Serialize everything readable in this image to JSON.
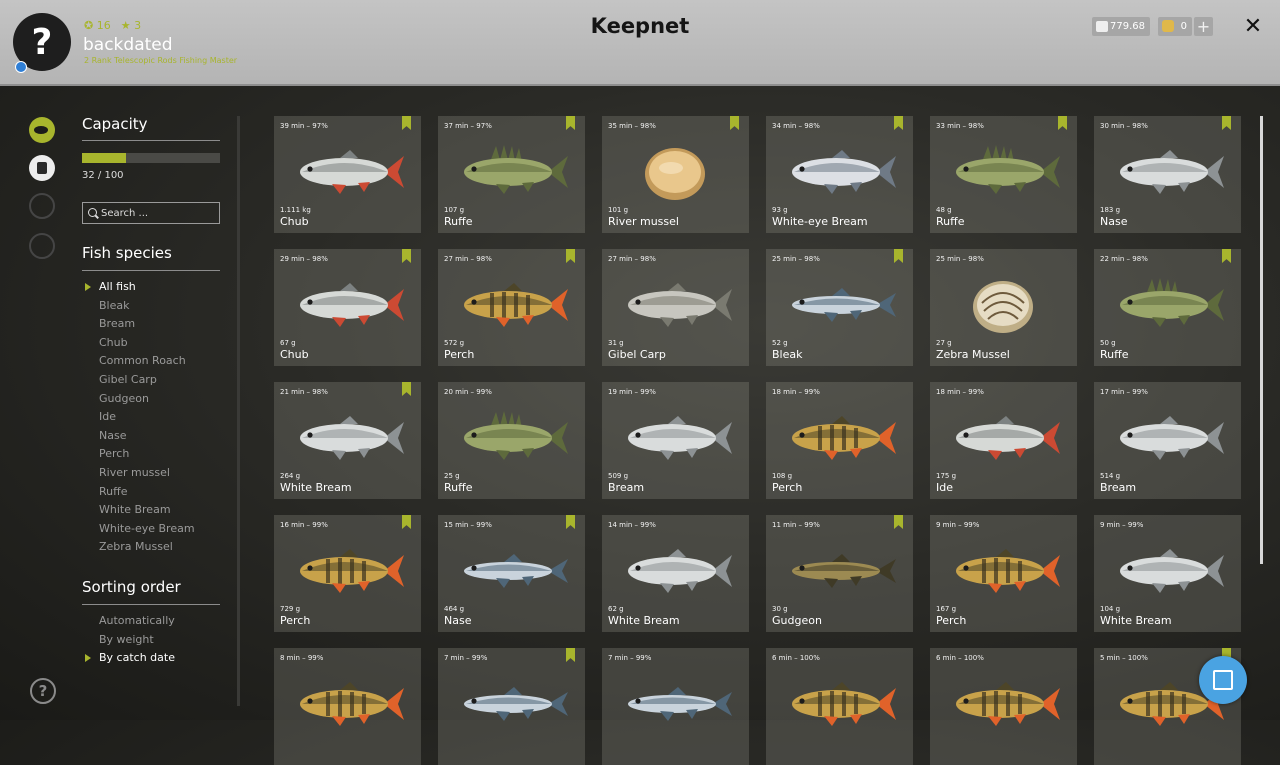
{
  "header": {
    "title": "Keepnet",
    "player": {
      "level_icon": "circle-level-icon",
      "level": "16",
      "rank_icon": "star-rank-icon",
      "rank": "3",
      "name": "backdated",
      "subtitle": "2 Rank Telescopic Rods Fishing Master"
    },
    "currency": {
      "silver": "779.68",
      "gold": "0"
    }
  },
  "sidebar": {
    "capacity": {
      "title": "Capacity",
      "used": 32,
      "max": 100,
      "label": "32 / 100"
    },
    "search": {
      "placeholder": "Search ..."
    },
    "species": {
      "title": "Fish species",
      "items": [
        "All fish",
        "Bleak",
        "Bream",
        "Chub",
        "Common Roach",
        "Gibel Carp",
        "Gudgeon",
        "Ide",
        "Nase",
        "Perch",
        "River mussel",
        "Ruffe",
        "White Bream",
        "White-eye Bream",
        "Zebra Mussel"
      ],
      "selected": "All fish"
    },
    "sorting": {
      "title": "Sorting order",
      "items": [
        "Automatically",
        "By weight",
        "By catch date"
      ],
      "selected": "By catch date"
    }
  },
  "colors": {
    "accent": "#a8b52d",
    "fab": "#4aa3e2"
  },
  "fish": [
    {
      "time": "39 min – 97%",
      "weight": "1.111 kg",
      "name": "Chub",
      "marked": true,
      "kind": "silver-red"
    },
    {
      "time": "37 min – 97%",
      "weight": "107 g",
      "name": "Ruffe",
      "marked": true,
      "kind": "spiny-green"
    },
    {
      "time": "35 min – 98%",
      "weight": "101 g",
      "name": "River mussel",
      "marked": true,
      "kind": "mussel-gold"
    },
    {
      "time": "34 min – 98%",
      "weight": "93 g",
      "name": "White-eye Bream",
      "marked": true,
      "kind": "silver-blue"
    },
    {
      "time": "33 min – 98%",
      "weight": "48 g",
      "name": "Ruffe",
      "marked": true,
      "kind": "spiny-green"
    },
    {
      "time": "30 min – 98%",
      "weight": "183 g",
      "name": "Nase",
      "marked": true,
      "kind": "silver"
    },
    {
      "time": "29 min – 98%",
      "weight": "67 g",
      "name": "Chub",
      "marked": true,
      "kind": "silver-red"
    },
    {
      "time": "27 min – 98%",
      "weight": "572 g",
      "name": "Perch",
      "marked": true,
      "kind": "perch"
    },
    {
      "time": "27 min – 98%",
      "weight": "31 g",
      "name": "Gibel Carp",
      "marked": false,
      "kind": "carp"
    },
    {
      "time": "25 min – 98%",
      "weight": "52 g",
      "name": "Bleak",
      "marked": true,
      "kind": "slim-blue"
    },
    {
      "time": "25 min – 98%",
      "weight": "27 g",
      "name": "Zebra Mussel",
      "marked": false,
      "kind": "mussel-striped"
    },
    {
      "time": "22 min – 98%",
      "weight": "50 g",
      "name": "Ruffe",
      "marked": true,
      "kind": "spiny-green"
    },
    {
      "time": "21 min – 98%",
      "weight": "264 g",
      "name": "White Bream",
      "marked": true,
      "kind": "silver"
    },
    {
      "time": "20 min – 99%",
      "weight": "25 g",
      "name": "Ruffe",
      "marked": false,
      "kind": "spiny-green"
    },
    {
      "time": "19 min – 99%",
      "weight": "509 g",
      "name": "Bream",
      "marked": false,
      "kind": "silver"
    },
    {
      "time": "18 min – 99%",
      "weight": "108 g",
      "name": "Perch",
      "marked": false,
      "kind": "perch"
    },
    {
      "time": "18 min – 99%",
      "weight": "175 g",
      "name": "Ide",
      "marked": false,
      "kind": "silver-red"
    },
    {
      "time": "17 min – 99%",
      "weight": "514 g",
      "name": "Bream",
      "marked": false,
      "kind": "silver"
    },
    {
      "time": "16 min – 99%",
      "weight": "729 g",
      "name": "Perch",
      "marked": true,
      "kind": "perch"
    },
    {
      "time": "15 min – 99%",
      "weight": "464 g",
      "name": "Nase",
      "marked": true,
      "kind": "slim-blue"
    },
    {
      "time": "14 min – 99%",
      "weight": "62 g",
      "name": "White Bream",
      "marked": false,
      "kind": "silver"
    },
    {
      "time": "11 min – 99%",
      "weight": "30 g",
      "name": "Gudgeon",
      "marked": true,
      "kind": "gudgeon"
    },
    {
      "time": "9 min – 99%",
      "weight": "167 g",
      "name": "Perch",
      "marked": false,
      "kind": "perch"
    },
    {
      "time": "9 min – 99%",
      "weight": "104 g",
      "name": "White Bream",
      "marked": false,
      "kind": "silver"
    },
    {
      "time": "8 min – 99%",
      "weight": "",
      "name": "",
      "marked": false,
      "kind": "perch"
    },
    {
      "time": "7 min – 99%",
      "weight": "",
      "name": "",
      "marked": true,
      "kind": "slim-blue"
    },
    {
      "time": "7 min – 99%",
      "weight": "",
      "name": "",
      "marked": false,
      "kind": "slim-blue"
    },
    {
      "time": "6 min – 100%",
      "weight": "",
      "name": "",
      "marked": false,
      "kind": "perch"
    },
    {
      "time": "6 min – 100%",
      "weight": "",
      "name": "",
      "marked": false,
      "kind": "perch"
    },
    {
      "time": "5 min – 100%",
      "weight": "",
      "name": "",
      "marked": true,
      "kind": "perch"
    }
  ]
}
